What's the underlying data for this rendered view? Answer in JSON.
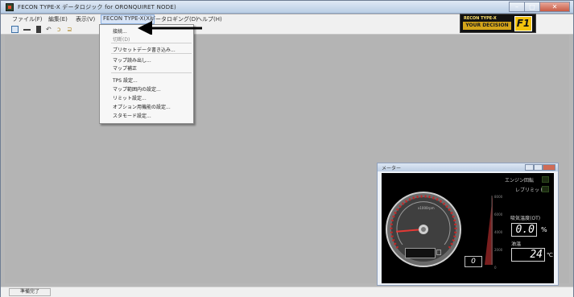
{
  "app": {
    "title": "FECON TYPE-X データロジック for ORONQUIRET NODE)"
  },
  "menu": {
    "items": [
      {
        "label": "ファイル(F)"
      },
      {
        "label": "編集(E)"
      },
      {
        "label": "表示(V)"
      },
      {
        "label": "FECON TYPE-X(X)"
      },
      {
        "label": "データロギング(D)"
      },
      {
        "label": "ヘルプ(H)"
      }
    ],
    "active_index": 3
  },
  "dropdown": {
    "items": [
      {
        "label": "接続...",
        "enabled": true
      },
      {
        "label": "切断(D)",
        "enabled": false
      },
      {
        "label": "プリセットデータ書き込み...",
        "enabled": true
      },
      {
        "label": "マップ読み出し...",
        "enabled": true
      },
      {
        "label": "マップ補正",
        "enabled": true
      },
      {
        "label": "TPS 設定...",
        "enabled": true
      },
      {
        "label": "マップ範囲内の設定...",
        "enabled": true
      },
      {
        "label": "リミット設定...",
        "enabled": true
      },
      {
        "label": "オプション用機能の設定...",
        "enabled": true
      },
      {
        "label": "スタモード設定...",
        "enabled": true
      }
    ]
  },
  "brand": {
    "line1": "RECON TYPE-X",
    "line2": "YOUR DECISION",
    "f1": "F1"
  },
  "toolbar": {
    "icons": [
      "new-file-icon",
      "minus-icon",
      "save-icon",
      "undo-icon",
      "folder-icon",
      "folder-open-icon"
    ]
  },
  "status_bar": {
    "text": "準備完了"
  },
  "meter_window": {
    "title": "メーター",
    "engine_label": "エンジン回転",
    "level_label": "レブリミット",
    "temp_label": "吸気温度(OT)",
    "temp_value": "0.0",
    "temp_unit": "%",
    "water_label": "油温",
    "water_value": "24",
    "water_unit": "℃",
    "gear_value": "0",
    "bar_ticks": [
      "8000",
      "6000",
      "4000",
      "2000",
      "0"
    ],
    "gauge_needle_fraction": 0.15,
    "accent_red": "#c62828"
  },
  "colors": {
    "client_gray": "#b4b4b4",
    "menu_highlight": "#d7e4f7"
  }
}
